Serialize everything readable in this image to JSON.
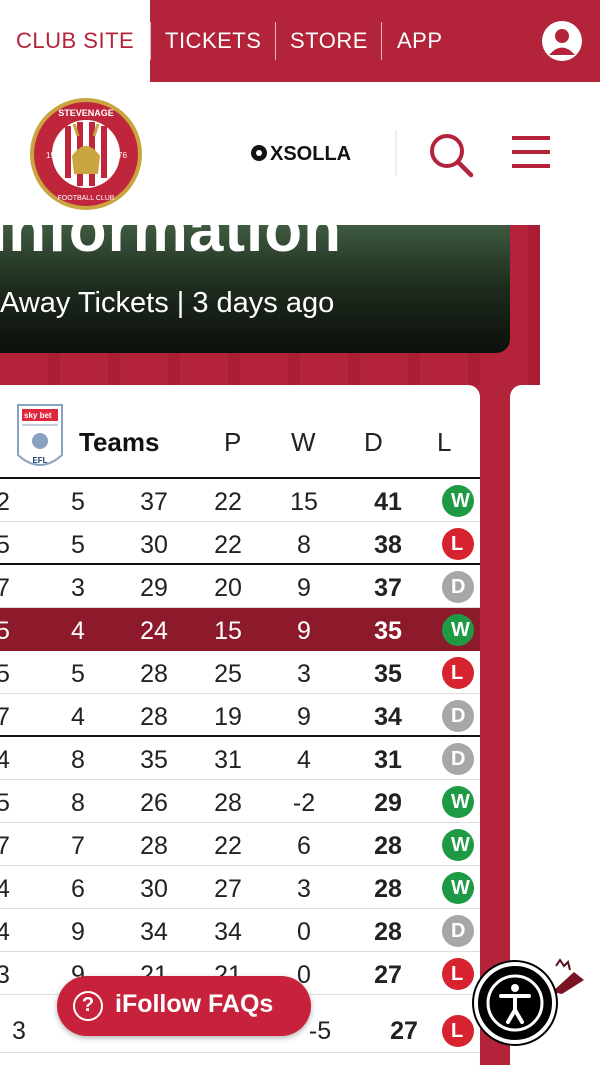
{
  "topnav": {
    "items": [
      {
        "label": "CLUB SITE",
        "active": true
      },
      {
        "label": "TICKETS"
      },
      {
        "label": "STORE"
      },
      {
        "label": "APP"
      }
    ],
    "account_icon": "user-icon"
  },
  "header": {
    "crest_icon": "club-crest-icon",
    "sponsor": "XSOLLA",
    "search_icon": "search-icon",
    "menu_icon": "hamburger-menu-icon"
  },
  "hero": {
    "title": "Information",
    "meta": "Away Tickets | 3 days ago"
  },
  "table": {
    "league_logo": "sky-bet-league-one-efl-logo",
    "headers": [
      "Teams",
      "P",
      "W",
      "D",
      "L"
    ],
    "rows": [
      {
        "a": "2",
        "b": "5",
        "c": "37",
        "d": "22",
        "e": "15",
        "pts": "41",
        "form": "W"
      },
      {
        "a": "5",
        "b": "5",
        "c": "30",
        "d": "22",
        "e": "8",
        "pts": "38",
        "form": "L"
      },
      {
        "a": "7",
        "b": "3",
        "c": "29",
        "d": "20",
        "e": "9",
        "pts": "37",
        "form": "D"
      },
      {
        "a": "5",
        "b": "4",
        "c": "24",
        "d": "15",
        "e": "9",
        "pts": "35",
        "form": "W",
        "highlight": true
      },
      {
        "a": "5",
        "b": "5",
        "c": "28",
        "d": "25",
        "e": "3",
        "pts": "35",
        "form": "L"
      },
      {
        "a": "7",
        "b": "4",
        "c": "28",
        "d": "19",
        "e": "9",
        "pts": "34",
        "form": "D"
      },
      {
        "a": "4",
        "b": "8",
        "c": "35",
        "d": "31",
        "e": "4",
        "pts": "31",
        "form": "D"
      },
      {
        "a": "5",
        "b": "8",
        "c": "26",
        "d": "28",
        "e": "-2",
        "pts": "29",
        "form": "W"
      },
      {
        "a": "7",
        "b": "7",
        "c": "28",
        "d": "22",
        "e": "6",
        "pts": "28",
        "form": "W"
      },
      {
        "a": "4",
        "b": "6",
        "c": "30",
        "d": "27",
        "e": "3",
        "pts": "28",
        "form": "W"
      },
      {
        "a": "4",
        "b": "9",
        "c": "34",
        "d": "34",
        "e": "0",
        "pts": "28",
        "form": "D"
      },
      {
        "a": "3",
        "b": "9",
        "c": "21",
        "d": "21",
        "e": "0",
        "pts": "27",
        "form": "L"
      },
      {
        "a": "3",
        "b": "",
        "c": "",
        "d": "",
        "e": "-5",
        "pts": "27",
        "form": "L"
      }
    ]
  },
  "faq_button": {
    "label": "iFollow FAQs",
    "icon": "question-circle-icon"
  },
  "accessibility_button": {
    "icon": "accessibility-icon"
  },
  "colors": {
    "brand": "#b3233a",
    "highlight_row": "#8c1a2b",
    "win": "#1e9a45",
    "loss": "#d6232f",
    "draw": "#a7a7a7"
  }
}
